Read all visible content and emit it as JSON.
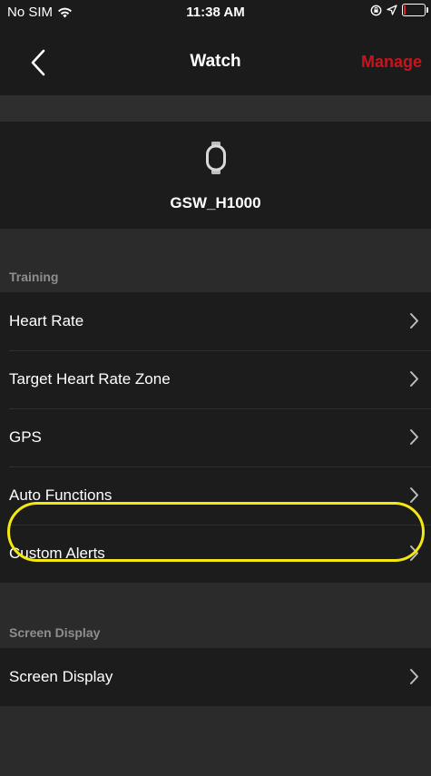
{
  "status_bar": {
    "carrier": "No SIM",
    "time": "11:38 AM",
    "icons": [
      "wifi-icon",
      "orientation-lock-icon",
      "location-arrow-icon",
      "battery-icon"
    ],
    "battery_color": "#e0202a"
  },
  "nav": {
    "title": "Watch",
    "action_label": "Manage",
    "action_color": "#c6161d"
  },
  "device": {
    "name": "GSW_H1000",
    "icon": "watch-icon"
  },
  "sections": [
    {
      "header": "Training",
      "items": [
        {
          "label": "Heart Rate"
        },
        {
          "label": "Target Heart Rate Zone"
        },
        {
          "label": "GPS"
        },
        {
          "label": "Auto Functions"
        },
        {
          "label": "Custom Alerts"
        }
      ]
    },
    {
      "header": "Screen Display",
      "items": [
        {
          "label": "Screen Display"
        }
      ]
    }
  ],
  "highlight_color": "#f4e811"
}
